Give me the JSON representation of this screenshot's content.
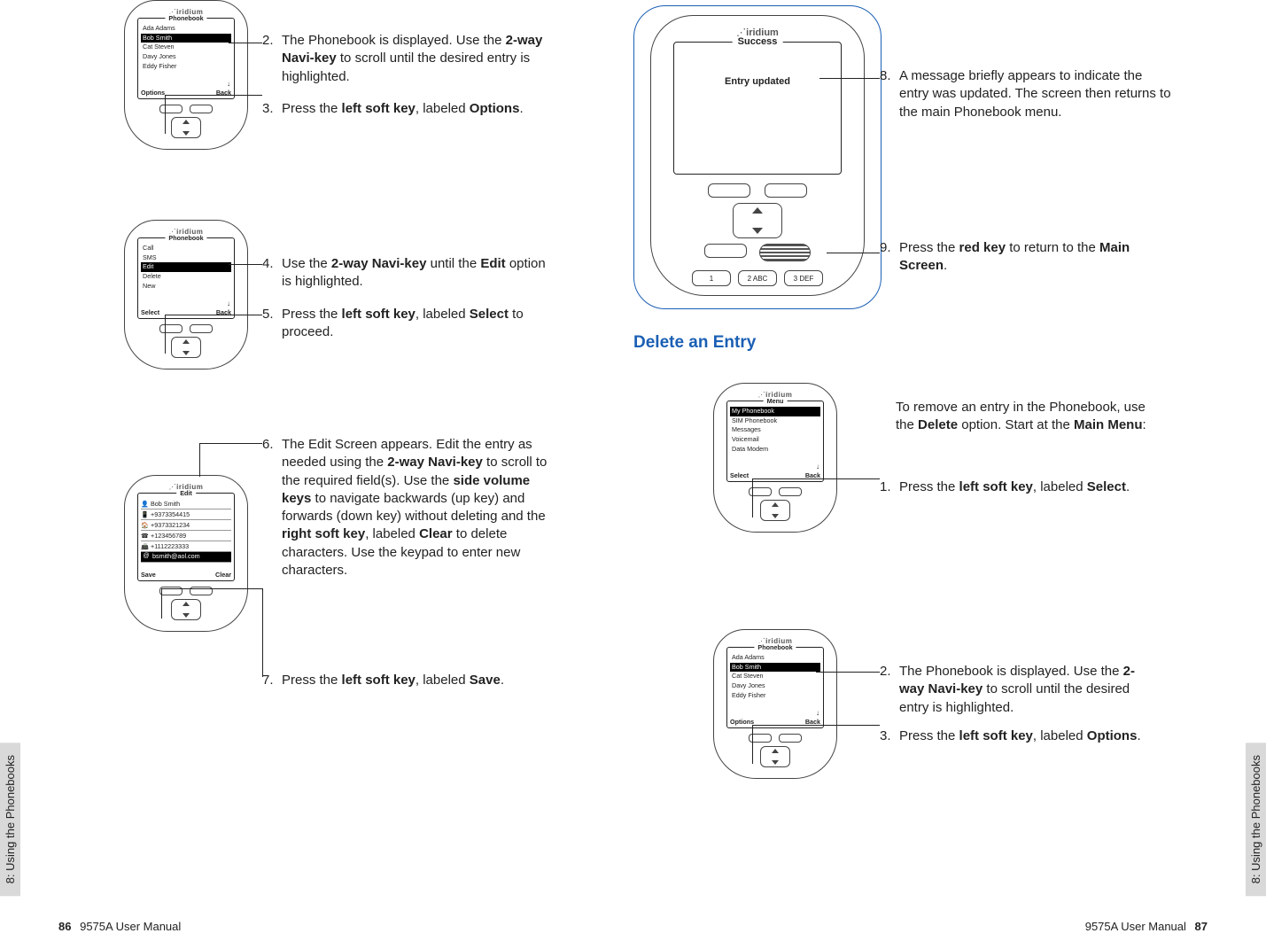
{
  "brand": "iridium",
  "left_page": {
    "tab": "8: Using the Phonebooks",
    "manual": "9575A User Manual",
    "page_number": "86",
    "phone1": {
      "screen_title": "Phonebook",
      "items": [
        "Ada Adams",
        "Bob Smith",
        "Cat Steven",
        "Davy Jones",
        "Eddy Fisher"
      ],
      "highlight_index": 1,
      "soft_left": "Options",
      "soft_right": "Back"
    },
    "step2": {
      "n": "2.",
      "text_a": "The Phonebook is displayed. Use the ",
      "b1": "2-way Navi-key",
      "text_b": " to scroll until the desired entry is highlighted."
    },
    "step3": {
      "n": "3.",
      "text_a": "Press the ",
      "b1": "left soft key",
      "text_b": ", labeled ",
      "b2": "Options",
      "text_c": "."
    },
    "phone2": {
      "screen_title": "Phonebook",
      "items": [
        "Call",
        "SMS",
        "Edit",
        "Delete",
        "New"
      ],
      "highlight_index": 2,
      "soft_left": "Select",
      "soft_right": "Back"
    },
    "step4": {
      "n": "4.",
      "text_a": "Use the ",
      "b1": "2-way Navi-key",
      "text_b": " until the ",
      "b2": "Edit",
      "text_c": " option is highlighted."
    },
    "step5": {
      "n": "5.",
      "text_a": "Press the ",
      "b1": "left soft key",
      "text_b": ", labeled ",
      "b2": "Select",
      "text_c": " to proceed."
    },
    "phone3": {
      "screen_title": "Edit",
      "fields": [
        {
          "icon": "person-icon",
          "value": "Bob Smith"
        },
        {
          "icon": "mobile-icon",
          "value": "+9373354415"
        },
        {
          "icon": "home-icon",
          "value": "+9373321234"
        },
        {
          "icon": "work-icon",
          "value": "+123456789"
        },
        {
          "icon": "fax-icon",
          "value": "+1112223333"
        },
        {
          "icon": "email-icon",
          "value": "bsmith@aol.com"
        }
      ],
      "highlight_index": 5,
      "soft_left": "Save",
      "soft_right": "Clear"
    },
    "step6": {
      "n": "6.",
      "text": "The Edit Screen appears. Edit the entry as needed using the <b>2-way Navi-key</b> to scroll to the required field(s). Use the <b>side volume keys</b> to navigate backwards (up key) and forwards (down key) without deleting and the <b>right soft key</b>, labeled <b>Clear</b> to delete characters. Use the keypad to enter new characters."
    },
    "step7": {
      "n": "7.",
      "text_a": "Press the ",
      "b1": "left soft key",
      "text_b": ", labeled ",
      "b2": "Save",
      "text_c": "."
    }
  },
  "right_page": {
    "tab": "8: Using the Phonebooks",
    "manual": "9575A User Manual",
    "page_number": "87",
    "bigphone": {
      "screen_title": "Success",
      "message": "Entry updated",
      "keypad": [
        "1",
        "2 ABC",
        "3 DEF"
      ]
    },
    "step8": {
      "n": "8.",
      "text": "A message briefly appears to indicate the entry was updated. The screen then returns to the main Phonebook menu."
    },
    "step9": {
      "n": "9.",
      "text_a": "Press the ",
      "b1": "red key",
      "text_b": " to return to the ",
      "b2": "Main Screen",
      "text_c": "."
    },
    "section_title": "Delete an Entry",
    "intro": {
      "text_a": "To remove an entry in the Phonebook, use the ",
      "b1": "Delete",
      "text_b": " option. Start at the ",
      "b2": "Main Menu",
      "text_c": ":"
    },
    "phone4": {
      "screen_title": "Menu",
      "items": [
        "My Phonebook",
        "SIM Phonebook",
        "Messages",
        "Voicemail",
        "Data Modem"
      ],
      "highlight_index": 0,
      "soft_left": "Select",
      "soft_right": "Back"
    },
    "dstep1": {
      "n": "1.",
      "text_a": "Press the ",
      "b1": "left soft key",
      "text_b": ", labeled ",
      "b2": "Select",
      "text_c": "."
    },
    "phone5": {
      "screen_title": "Phonebook",
      "items": [
        "Ada Adams",
        "Bob Smith",
        "Cat Steven",
        "Davy Jones",
        "Eddy Fisher"
      ],
      "highlight_index": 1,
      "soft_left": "Options",
      "soft_right": "Back"
    },
    "dstep2": {
      "n": "2.",
      "text_a": "The Phonebook is displayed. Use the ",
      "b1": "2-way Navi-key",
      "text_b": " to scroll until the desired entry is highlighted."
    },
    "dstep3": {
      "n": "3.",
      "text_a": "Press the ",
      "b1": "left soft key",
      "text_b": ", labeled ",
      "b2": "Options",
      "text_c": "."
    }
  }
}
